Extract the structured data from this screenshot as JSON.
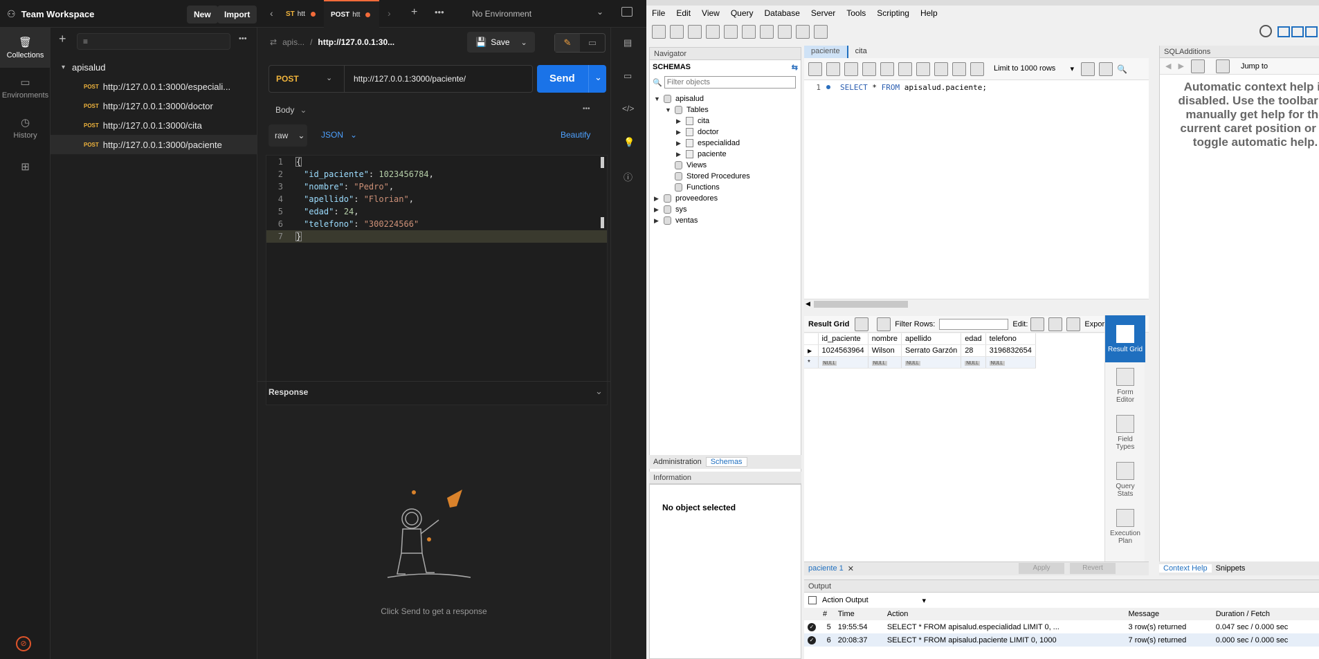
{
  "postman": {
    "workspace": "Team Workspace",
    "new_label": "New",
    "import_label": "Import",
    "tabs": [
      {
        "method": "ST",
        "name": "htt"
      },
      {
        "method": "POST",
        "name": "htt"
      }
    ],
    "environment": "No Environment",
    "rail": [
      {
        "label": "Collections",
        "icon": "collections-icon"
      },
      {
        "label": "Environments",
        "icon": "environments-icon"
      },
      {
        "label": "History",
        "icon": "history-icon"
      }
    ],
    "collection": "apisalud",
    "requests": [
      {
        "method": "POST",
        "url": "http://127.0.0.1:3000/especiali..."
      },
      {
        "method": "POST",
        "url": "http://127.0.0.1:3000/doctor"
      },
      {
        "method": "POST",
        "url": "http://127.0.0.1:3000/cita"
      },
      {
        "method": "POST",
        "url": "http://127.0.0.1:3000/paciente"
      }
    ],
    "breadcrumb_parent": "apis...",
    "breadcrumb_sep": "/",
    "breadcrumb_current": "http://127.0.0.1:30...",
    "save_label": "Save",
    "method": "POST",
    "url": "http://127.0.0.1:3000/paciente/",
    "send_label": "Send",
    "body_label": "Body",
    "raw_label": "raw",
    "json_label": "JSON",
    "beautify_label": "Beautify",
    "code_lines": [
      {
        "n": "1",
        "text": "{"
      },
      {
        "n": "2",
        "key": "\"id_paciente\"",
        "val": "1023456784",
        "type": "num",
        "comma": ","
      },
      {
        "n": "3",
        "key": "\"nombre\"",
        "val": "\"Pedro\"",
        "type": "str",
        "comma": ","
      },
      {
        "n": "4",
        "key": "\"apellido\"",
        "val": "\"Florian\"",
        "type": "str",
        "comma": ","
      },
      {
        "n": "5",
        "key": "\"edad\"",
        "val": "24",
        "type": "num",
        "comma": ","
      },
      {
        "n": "6",
        "key": "\"telefono\"",
        "val": "\"300224566\"",
        "type": "str",
        "comma": ""
      },
      {
        "n": "7",
        "text": "}"
      }
    ],
    "response_label": "Response",
    "empty_response": "Click Send to get a response"
  },
  "workbench": {
    "menu": [
      "File",
      "Edit",
      "View",
      "Query",
      "Database",
      "Server",
      "Tools",
      "Scripting",
      "Help"
    ],
    "navigator_label": "Navigator",
    "schemas_label": "SCHEMAS",
    "filter_placeholder": "Filter objects",
    "tree": [
      {
        "label": "apisalud",
        "level": 0,
        "expanded": true,
        "kind": "db"
      },
      {
        "label": "Tables",
        "level": 1,
        "expanded": true,
        "kind": "folder"
      },
      {
        "label": "cita",
        "level": 2,
        "expanded": false,
        "kind": "table"
      },
      {
        "label": "doctor",
        "level": 2,
        "expanded": false,
        "kind": "table"
      },
      {
        "label": "especialidad",
        "level": 2,
        "expanded": false,
        "kind": "table"
      },
      {
        "label": "paciente",
        "level": 2,
        "expanded": false,
        "kind": "table"
      },
      {
        "label": "Views",
        "level": 1,
        "expanded": null,
        "kind": "folder"
      },
      {
        "label": "Stored Procedures",
        "level": 1,
        "expanded": null,
        "kind": "folder"
      },
      {
        "label": "Functions",
        "level": 1,
        "expanded": null,
        "kind": "folder"
      },
      {
        "label": "proveedores",
        "level": 0,
        "expanded": false,
        "kind": "db"
      },
      {
        "label": "sys",
        "level": 0,
        "expanded": false,
        "kind": "db"
      },
      {
        "label": "ventas",
        "level": 0,
        "expanded": false,
        "kind": "db"
      }
    ],
    "nav_tabs": [
      "Administration",
      "Schemas"
    ],
    "information_label": "Information",
    "no_object": "No object selected",
    "editor_tabs": [
      "paciente",
      "cita"
    ],
    "limit_label": "Limit to 1000 rows",
    "sql_line_no": "1",
    "sql_keyword1": "SELECT",
    "sql_rest1": " * ",
    "sql_keyword2": "FROM",
    "sql_rest2": " apisalud.paciente;",
    "result_grid_label": "Result Grid",
    "filter_rows_label": "Filter Rows:",
    "edit_label": "Edit:",
    "export_label": "Export/Im",
    "columns": [
      "id_paciente",
      "nombre",
      "apellido",
      "edad",
      "telefono"
    ],
    "rows": [
      [
        "1024563964",
        "Wilson",
        "Serrato Garzón",
        "28",
        "3196832654"
      ]
    ],
    "null_label": "NULL",
    "side_tools": [
      "Result Grid",
      "Form Editor",
      "Field Types",
      "Query Stats",
      "Execution Plan"
    ],
    "result_tab": "paciente 1",
    "apply_label": "Apply",
    "revert_label": "Revert",
    "sqladditions_label": "SQLAdditions",
    "jump_to": "Jump to",
    "context_help_text": "Automatic context help is disabled. Use the toolbar to manually get help for the current caret position or to toggle automatic help.",
    "bottom_tabs": [
      "Context Help",
      "Snippets"
    ],
    "output_label": "Output",
    "action_output": "Action Output",
    "out_headers": [
      "#",
      "Time",
      "Action",
      "Message",
      "Duration / Fetch"
    ],
    "out_rows": [
      [
        "5",
        "19:55:54",
        "SELECT * FROM apisalud.especialidad LIMIT 0, ...",
        "3 row(s) returned",
        "0.047 sec / 0.000 sec"
      ],
      [
        "6",
        "20:08:37",
        "SELECT * FROM apisalud.paciente LIMIT 0, 1000",
        "7 row(s) returned",
        "0.000 sec / 0.000 sec"
      ]
    ]
  }
}
